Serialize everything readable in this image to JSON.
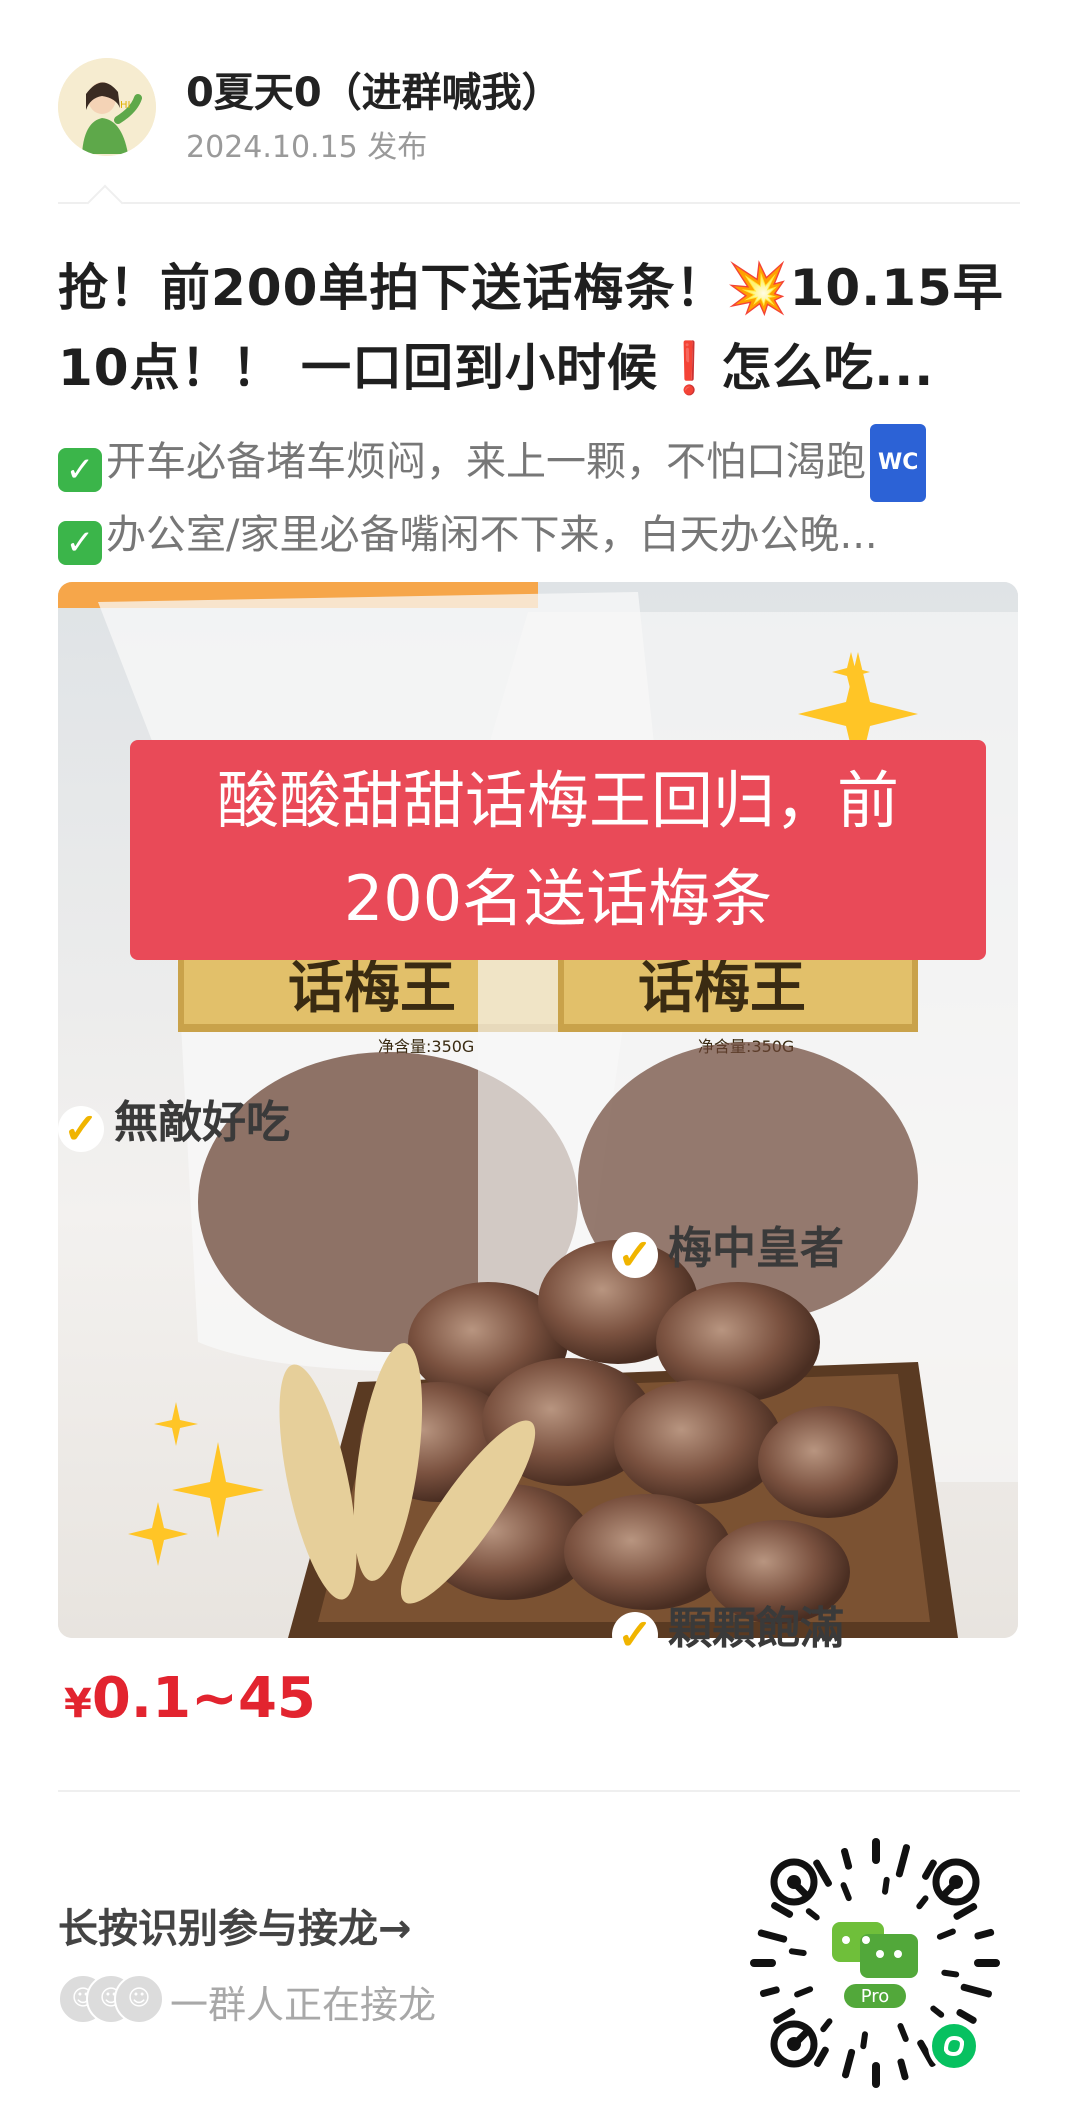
{
  "post": {
    "author": "0夏天0（进群喊我）",
    "date": "2024.10.15 发布",
    "title_line1": "抢！前200单拍下送话梅条！💥10.15早",
    "title_line2": "10点！！  一口回到小时候❗怎么吃...",
    "desc_line1": "开车必备堵车烦闷，来上一颗，不怕口渴跑",
    "desc_badge": "WC",
    "desc_line2": "办公室/家里必备嘴闲不下来，白天办公晚..."
  },
  "image": {
    "overlay_line1": "酸酸甜甜话梅王回归，前",
    "overlay_line2": "200名送话梅条",
    "package_brand": "话梅王",
    "package_weight": "净含量:350G",
    "label_1": "無敵好吃",
    "label_2": "梅中皇者",
    "label_3": "顆顆飽滿"
  },
  "price": {
    "currency": "¥",
    "range": "0.1~45"
  },
  "footer": {
    "cta": "长按识别参与接龙→",
    "participants_text": "一群人正在接龙",
    "qr_label": "Pro"
  },
  "colors": {
    "price_red": "#e2242f",
    "overlay_red": "#e94a58",
    "check_green": "#3bb54a",
    "wc_blue": "#2c62d6"
  }
}
